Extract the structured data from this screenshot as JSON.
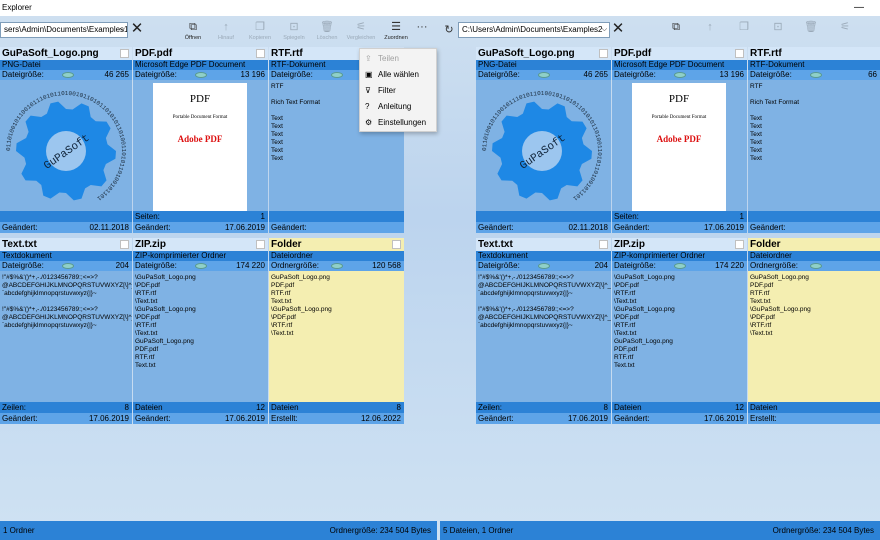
{
  "app": {
    "title": "Explorer",
    "minimize_glyph": "—"
  },
  "toolbar": {
    "open": "Öffnen",
    "up": "Hinauf",
    "copy": "Kopieren",
    "mirror": "Spiegeln",
    "delete": "Löschen",
    "compare": "Vergleichen",
    "arrange": "Zuordnen",
    "more": "···"
  },
  "menu": {
    "items": [
      {
        "label": "Teilen",
        "icon": "share-icon",
        "glyph": "⇪"
      },
      {
        "label": "Alle wählen",
        "icon": "select-all-icon",
        "glyph": "▣"
      },
      {
        "label": "Filter",
        "icon": "filter-icon",
        "glyph": "⊽"
      },
      {
        "label": "Anleitung",
        "icon": "help-icon",
        "glyph": "?"
      },
      {
        "label": "Einstellungen",
        "icon": "gear-icon",
        "glyph": "⚙"
      }
    ]
  },
  "left": {
    "path": "sers\\Admin\\Documents\\Examples1",
    "status_left": "1 Ordner",
    "status_right": "Ordnergröße: 234 504 Bytes",
    "tiles": {
      "png": {
        "name": "GuPaSoft_Logo.png",
        "type": "PNG-Datei",
        "size_label": "Dateigröße:",
        "size": "46 265",
        "f1_label": "",
        "f1": "",
        "f2_label": "Geändert:",
        "f2": "02.11.2018"
      },
      "pdf": {
        "name": "PDF.pdf",
        "type": "Microsoft Edge PDF Document",
        "size_label": "Dateigröße:",
        "size": "13 196",
        "f1_label": "Seiten:",
        "f1": "1",
        "f2_label": "Geändert:",
        "f2": "17.06.2019"
      },
      "rtf": {
        "name": "RTF.rtf",
        "type": "RTF-Dokument",
        "size_label": "Dateigröße:",
        "size": "",
        "f1_label": "",
        "f1": "",
        "f2_label": "Geändert:",
        "f2": ""
      },
      "txt": {
        "name": "Text.txt",
        "type": "Textdokument",
        "size_label": "Dateigröße:",
        "size": "204",
        "f1_label": "Zeilen:",
        "f1": "8",
        "f2_label": "Geändert:",
        "f2": "17.06.2019"
      },
      "zip": {
        "name": "ZIP.zip",
        "type": "ZIP-komprimierter Ordner",
        "size_label": "Dateigröße:",
        "size": "174 220",
        "f1_label": "Dateien",
        "f1": "12",
        "f2_label": "Geändert:",
        "f2": "17.06.2019"
      },
      "folder": {
        "name": "Folder",
        "type": "Dateiordner",
        "size_label": "Ordnergröße:",
        "size": "120 568",
        "f1_label": "Dateien",
        "f1": "8",
        "f2_label": "Erstellt:",
        "f2": "12.06.2022"
      }
    }
  },
  "right": {
    "path": "C:\\Users\\Admin\\Documents\\Examples2",
    "status_left": "5 Dateien, 1 Ordner",
    "status_right": "Ordnergröße: 234 504 Bytes",
    "tiles": {
      "png": {
        "name": "GuPaSoft_Logo.png",
        "type": "PNG-Datei",
        "size_label": "Dateigröße:",
        "size": "46 265",
        "f1_label": "",
        "f1": "",
        "f2_label": "Geändert:",
        "f2": "02.11.2018"
      },
      "pdf": {
        "name": "PDF.pdf",
        "type": "Microsoft Edge PDF Document",
        "size_label": "Dateigröße:",
        "size": "13 196",
        "f1_label": "Seiten:",
        "f1": "1",
        "f2_label": "Geändert:",
        "f2": "17.06.2019"
      },
      "rtf": {
        "name": "RTF.rtf",
        "type": "RTF-Dokument",
        "size_label": "Dateigröße:",
        "size": "66",
        "f1_label": "",
        "f1": "",
        "f2_label": "Geändert:",
        "f2": ""
      },
      "txt": {
        "name": "Text.txt",
        "type": "Textdokument",
        "size_label": "Dateigröße:",
        "size": "204",
        "f1_label": "Zeilen:",
        "f1": "8",
        "f2_label": "Geändert:",
        "f2": "17.06.2019"
      },
      "zip": {
        "name": "ZIP.zip",
        "type": "ZIP-komprimierter Ordner",
        "size_label": "Dateigröße:",
        "size": "174 220",
        "f1_label": "Dateien",
        "f1": "12",
        "f2_label": "Geändert:",
        "f2": "17.06.2019"
      },
      "folder": {
        "name": "Folder",
        "type": "Dateiordner",
        "size_label": "Ordnergröße:",
        "size": "",
        "f1_label": "Dateien",
        "f1": "",
        "f2_label": "Erstellt:",
        "f2": ""
      }
    }
  },
  "previews": {
    "pdf_title": "PDF",
    "pdf_subtitle": "Portable Document Format",
    "pdf_logo": "Adobe PDF",
    "logo_text": "GuPaSoft",
    "logo_ring": "0110100101100101110101101001011010110101011010011010110100101101",
    "rtf_lines": [
      "RTF",
      "",
      "Rich Text Format",
      "",
      "Text",
      "Text",
      "Text",
      "Text",
      "Text",
      "Text"
    ],
    "txt_lines": [
      "!\"#$%&'()*+,-./0123456789:;<=>?",
      "@ABCDEFGHIJKLMNOPQRSTUVWXYZ[\\]^_",
      "`abcdefghijklmnopqrstuvwxyz{|}~",
      "",
      "!\"#$%&'()*+,-./0123456789:;<=>?",
      "@ABCDEFGHIJKLMNOPQRSTUVWXYZ[\\]^_",
      "`abcdefghijklmnopqrstuvwxyz{|}~"
    ],
    "zip_lines": [
      "\\GuPaSoft_Logo.png",
      "\\PDF.pdf",
      "\\RTF.rtf",
      "\\Text.txt",
      "\\GuPaSoft_Logo.png",
      "\\PDF.pdf",
      "\\RTF.rtf",
      "\\Text.txt",
      "GuPaSoft_Logo.png",
      "PDF.pdf",
      "RTF.rtf",
      "Text.txt"
    ],
    "folder_lines": [
      "GuPaSoft_Logo.png",
      "PDF.pdf",
      "RTF.rtf",
      "Text.txt",
      "\\GuPaSoft_Logo.png",
      "\\PDF.pdf",
      "\\RTF.rtf",
      "\\Text.txt"
    ]
  },
  "colors": {
    "tile": "#7fb2e4",
    "band": "#2c82d6",
    "folder": "#f4eeb1",
    "gear": "#1e88e5"
  }
}
